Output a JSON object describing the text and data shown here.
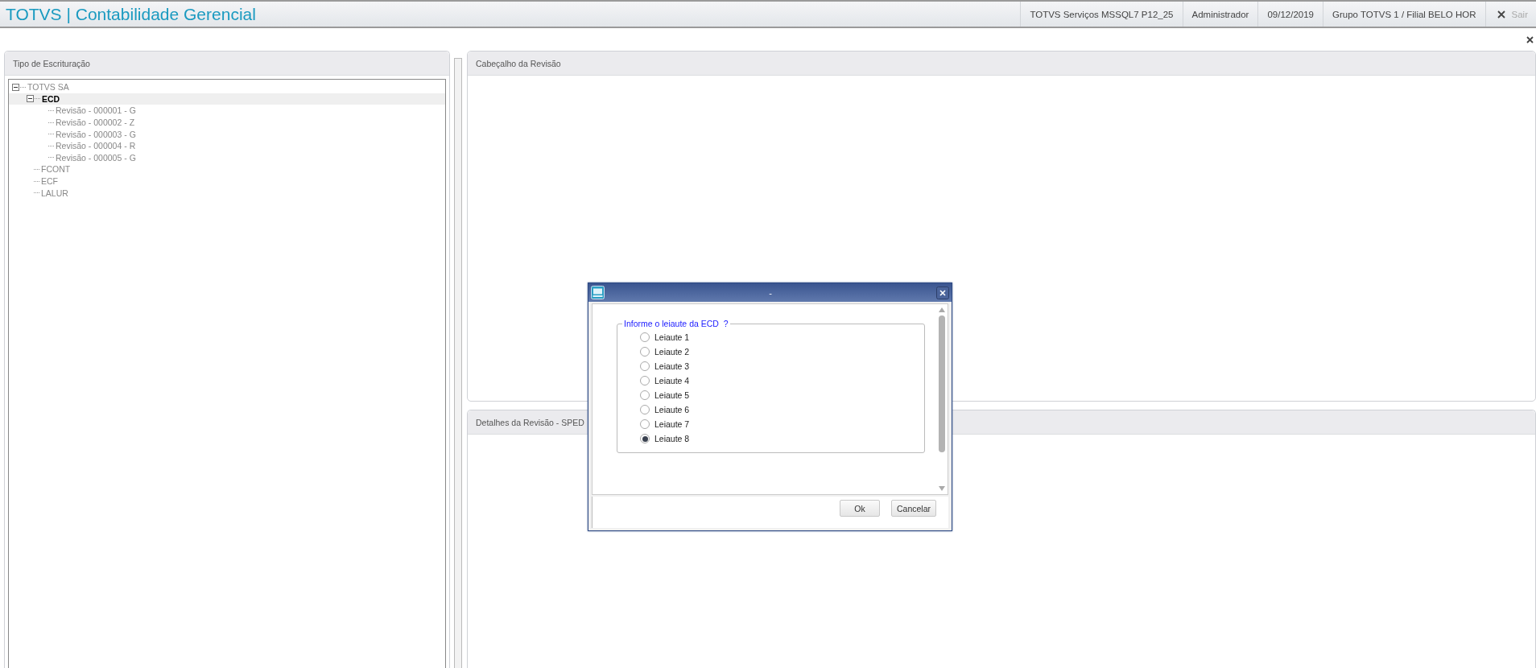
{
  "header": {
    "title": "TOTVS | Contabilidade Gerencial",
    "info": [
      "TOTVS Serviços MSSQL7 P12_25",
      "Administrador",
      "09/12/2019",
      "Grupo TOTVS 1 / Filial BELO HOR"
    ],
    "exit_label": "Sair"
  },
  "left_panel": {
    "title": "Tipo de Escrituração",
    "tree": [
      {
        "label": "TOTVS SA",
        "selected": false,
        "expanded": true,
        "children": [
          {
            "label": "ECD",
            "selected": true,
            "expanded": true,
            "children": [
              {
                "label": "Revisão - 000001 - G",
                "selected": false
              },
              {
                "label": "Revisão - 000002 - Z",
                "selected": false
              },
              {
                "label": "Revisão - 000003 - G",
                "selected": false
              },
              {
                "label": "Revisão - 000004 - R",
                "selected": false
              },
              {
                "label": "Revisão - 000005 - G",
                "selected": false
              }
            ]
          },
          {
            "label": "FCONT",
            "selected": false
          },
          {
            "label": "ECF",
            "selected": false
          },
          {
            "label": "LALUR",
            "selected": false
          }
        ]
      }
    ]
  },
  "top_panel": {
    "title": "Cabeçalho da Revisão"
  },
  "bottom_panel": {
    "title": "Detalhes da Revisão - SPED"
  },
  "dialog": {
    "title": "-",
    "question": "Informe o leiaute da ECD  ?",
    "options": [
      {
        "label": "Leiaute 1",
        "selected": false
      },
      {
        "label": "Leiaute 2",
        "selected": false
      },
      {
        "label": "Leiaute 3",
        "selected": false
      },
      {
        "label": "Leiaute 4",
        "selected": false
      },
      {
        "label": "Leiaute 5",
        "selected": false
      },
      {
        "label": "Leiaute 6",
        "selected": false
      },
      {
        "label": "Leiaute 7",
        "selected": false
      },
      {
        "label": "Leiaute 8",
        "selected": true
      }
    ],
    "buttons": [
      "Ok",
      "Cancelar"
    ]
  }
}
